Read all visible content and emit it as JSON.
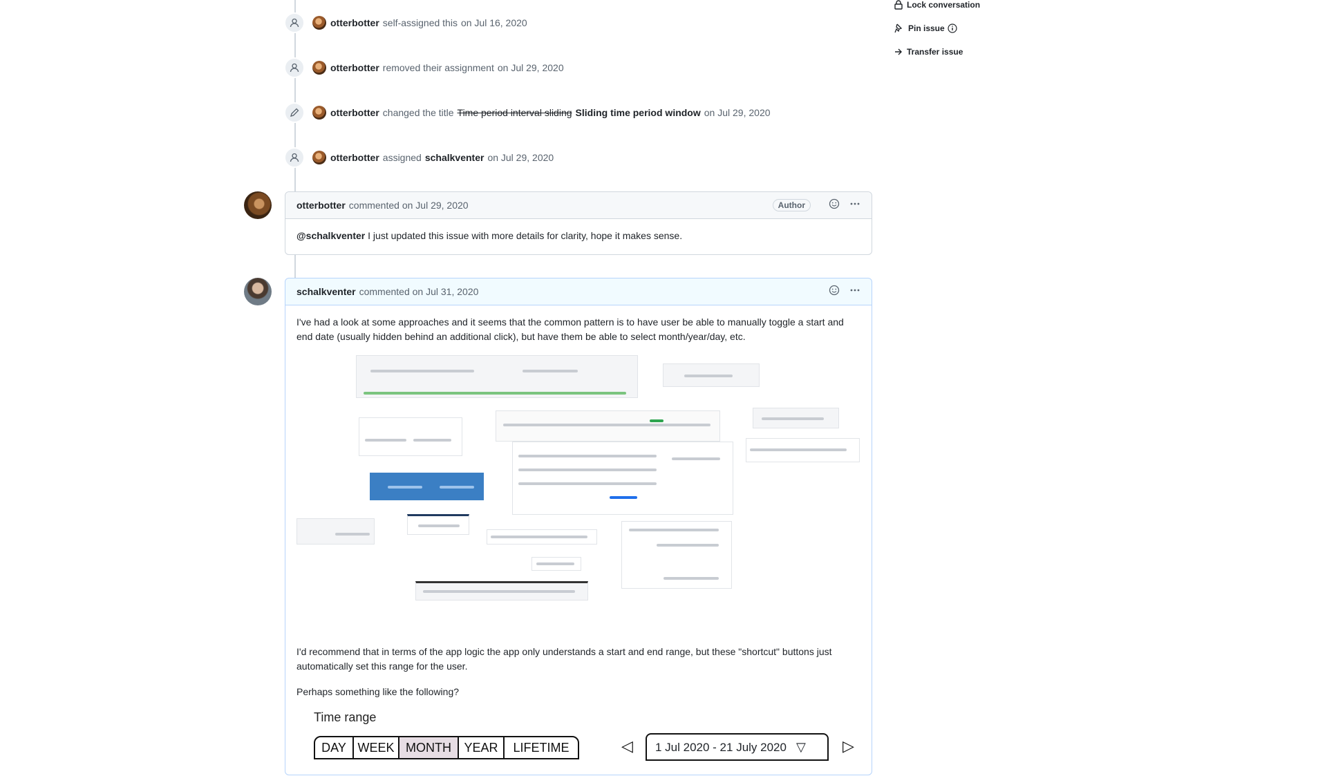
{
  "sidebar": {
    "lock": "Lock conversation",
    "pin": "Pin issue",
    "transfer": "Transfer issue"
  },
  "events": [
    {
      "actor": "otterbotter",
      "text": "self-assigned this",
      "date": "on Jul 16, 2020"
    },
    {
      "actor": "otterbotter",
      "text": "removed their assignment",
      "date": "on Jul 29, 2020"
    },
    {
      "actor": "otterbotter",
      "text": "changed the title",
      "old_title": "Time period interval sliding",
      "new_title": "Sliding time period window",
      "date": "on Jul 29, 2020"
    },
    {
      "actor": "otterbotter",
      "text": "assigned",
      "target": "schalkventer",
      "date": "on Jul 29, 2020"
    }
  ],
  "comment1": {
    "author": "otterbotter",
    "meta": "commented on Jul 29, 2020",
    "badge": "Author",
    "mention": "@schalkventer",
    "body": " I just updated this issue with more details for clarity, hope it makes sense."
  },
  "comment2": {
    "author": "schalkventer",
    "meta": "commented on Jul 31, 2020",
    "p1": "I've had a look at some approaches and it seems that the common pattern is to have user be able to manually toggle a start and end date (usually hidden behind an additional click), but have them be able to select month/year/day, etc.",
    "p2": "I'd recommend that in terms of the app logic the app only understands a start and end range, but these \"shortcut\" buttons just automatically set this range for the user.",
    "p3": "Perhaps something like the following?"
  },
  "sketch": {
    "title": "Time range",
    "tabs": [
      "DAY",
      "WEEK",
      "MONTH",
      "YEAR",
      "LIFETIME"
    ],
    "active_tab": "MONTH",
    "range": "1 Jul 2020 - 21 July 2020"
  },
  "icons": {
    "emoji": "smiley-icon",
    "more": "kebab-horizontal-icon"
  }
}
